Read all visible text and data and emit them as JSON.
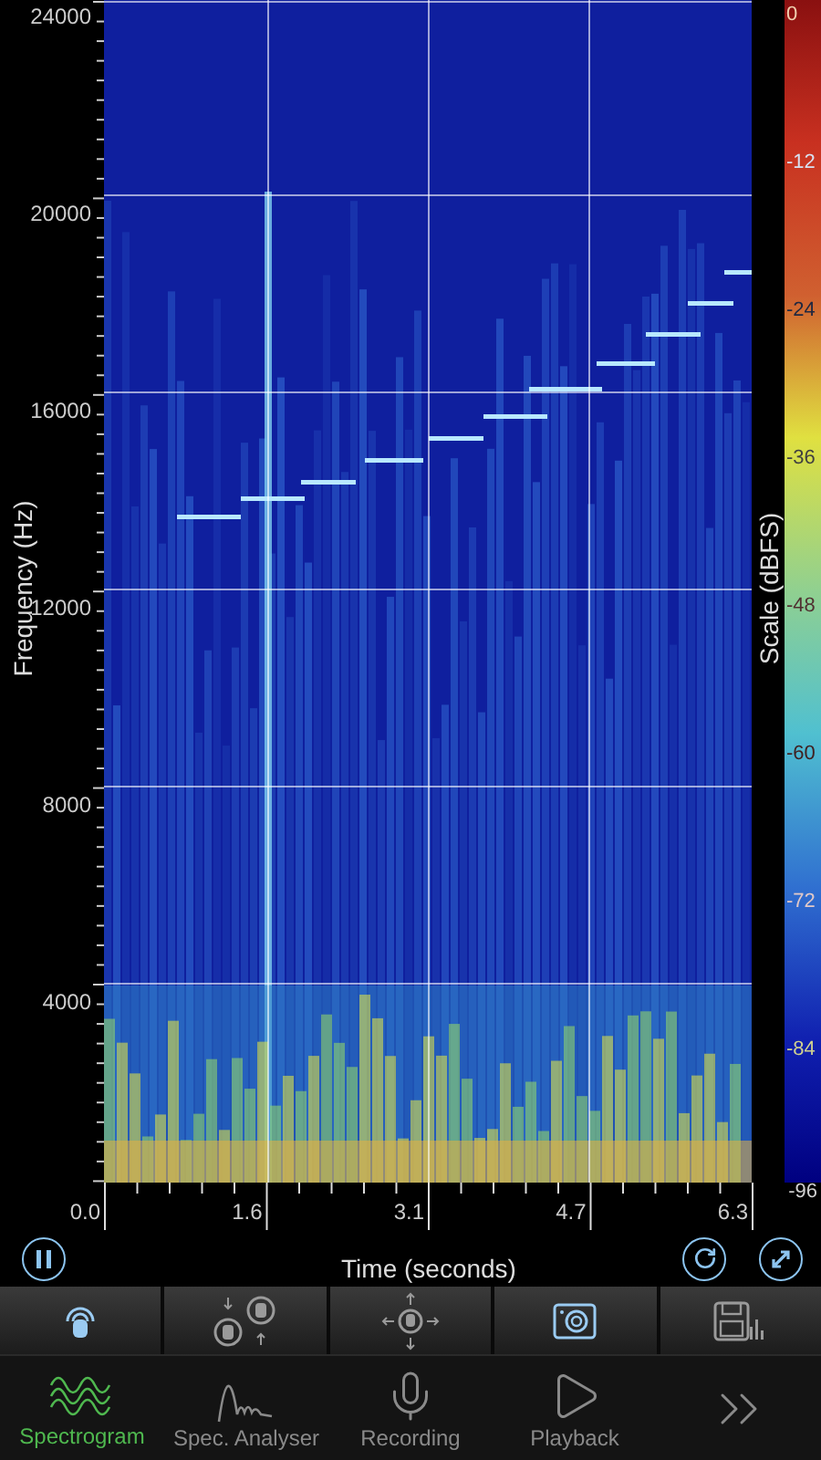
{
  "plot": {
    "y_axis_title": "Frequency (Hz)",
    "y_ticks": [
      "24000",
      "20000",
      "16000",
      "12000",
      "8000",
      "4000"
    ],
    "x_ticks": [
      "0.0",
      "1.6",
      "3.1",
      "4.7",
      "6.3"
    ],
    "x_axis_title": "Time (seconds)"
  },
  "scale": {
    "title": "Scale (dBFS)",
    "labels": [
      "0",
      "-12",
      "-24",
      "-36",
      "-48",
      "-60",
      "-72",
      "-84",
      "-96"
    ]
  },
  "toolbar": [
    {
      "kind": "lock",
      "active": true
    },
    {
      "kind": "swap",
      "active": false
    },
    {
      "kind": "move",
      "active": false
    },
    {
      "kind": "snapshot",
      "active": true
    },
    {
      "kind": "save",
      "active": false
    }
  ],
  "tabs": [
    {
      "kind": "spectrogram",
      "label": "Spectrogram",
      "selected": true
    },
    {
      "kind": "analyser",
      "label": "Spec. Analyser",
      "selected": false
    },
    {
      "kind": "recording",
      "label": "Recording",
      "selected": false
    },
    {
      "kind": "playback",
      "label": "Playback",
      "selected": false
    },
    {
      "kind": "more",
      "selected": false
    }
  ]
}
